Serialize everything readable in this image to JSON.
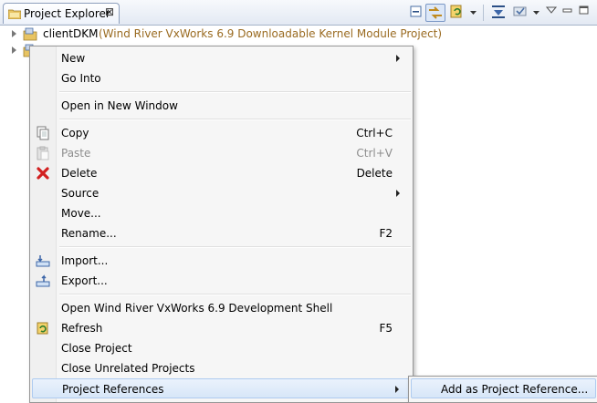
{
  "view": {
    "tab_title": "Project Explorer",
    "close_glyph": "⊠"
  },
  "toolbar": {
    "icons": [
      "collapse-all-icon",
      "link-with-editor-icon",
      "refresh-view-icon",
      "view-menu-dropdown-icon",
      "filter-icon",
      "customize-view-icon",
      "view-dropdown-icon",
      "minimize-icon",
      "maximize-icon"
    ]
  },
  "tree": {
    "items": [
      {
        "name": "clientDKM",
        "description": "(Wind River VxWorks 6.9 Downloadable Kernel Module Project)"
      }
    ]
  },
  "menu": {
    "items": [
      {
        "label": "New",
        "submenu": true
      },
      {
        "label": "Go Into"
      },
      {
        "label": "Open in New Window"
      },
      {
        "label": "Copy",
        "shortcut": "Ctrl+C",
        "icon": "copy-icon"
      },
      {
        "label": "Paste",
        "shortcut": "Ctrl+V",
        "icon": "paste-icon",
        "disabled": true
      },
      {
        "label": "Delete",
        "shortcut": "Delete",
        "icon": "delete-icon"
      },
      {
        "label": "Source",
        "submenu": true
      },
      {
        "label": "Move..."
      },
      {
        "label": "Rename...",
        "shortcut": "F2"
      },
      {
        "label": "Import...",
        "icon": "import-icon"
      },
      {
        "label": "Export...",
        "icon": "export-icon"
      },
      {
        "label": "Open Wind River VxWorks 6.9 Development Shell"
      },
      {
        "label": "Refresh",
        "shortcut": "F5",
        "icon": "refresh-icon"
      },
      {
        "label": "Close Project"
      },
      {
        "label": "Close Unrelated Projects"
      },
      {
        "label": "Project References",
        "submenu": true,
        "active": true
      }
    ]
  },
  "submenu": {
    "items": [
      {
        "label": "Add as Project Reference..."
      }
    ]
  },
  "colors": {
    "description_text": "#9a6b21",
    "delete_icon": "#d22020",
    "menu_hover_bg": "#d7e6f8",
    "menu_hover_border": "#aecbf0"
  }
}
